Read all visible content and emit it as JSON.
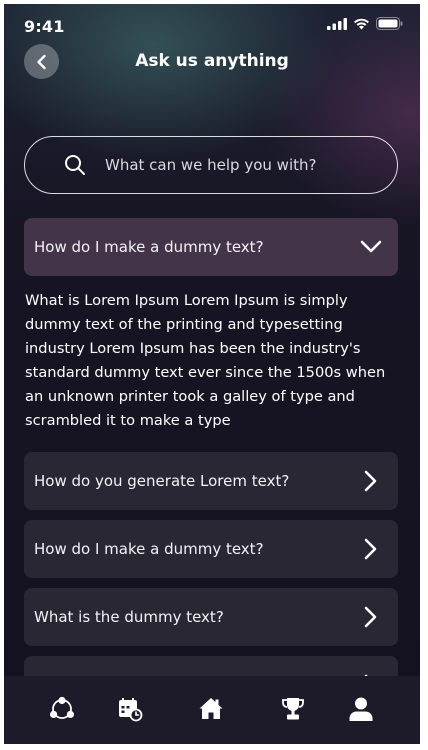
{
  "status": {
    "time": "9:41"
  },
  "header": {
    "title": "Ask us anything"
  },
  "search": {
    "placeholder": "What can we help you with?"
  },
  "faq": {
    "open_item": {
      "question": "How do I make a dummy text?",
      "answer": "What is Lorem Ipsum Lorem Ipsum is simply dummy text of the printing and typesetting industry Lorem Ipsum has been the industry's standard dummy text ever since the 1500s when an unknown printer took a galley of type and scrambled it to make a type"
    },
    "items": [
      {
        "question": "How do you generate Lorem text?"
      },
      {
        "question": "How do I make a dummy text?"
      },
      {
        "question": "What is the dummy text?"
      },
      {
        "question": ""
      }
    ]
  },
  "nav": {
    "items": [
      {
        "icon": "community-icon"
      },
      {
        "icon": "calendar-icon"
      },
      {
        "icon": "home-icon"
      },
      {
        "icon": "trophy-icon"
      },
      {
        "icon": "profile-icon"
      }
    ]
  }
}
